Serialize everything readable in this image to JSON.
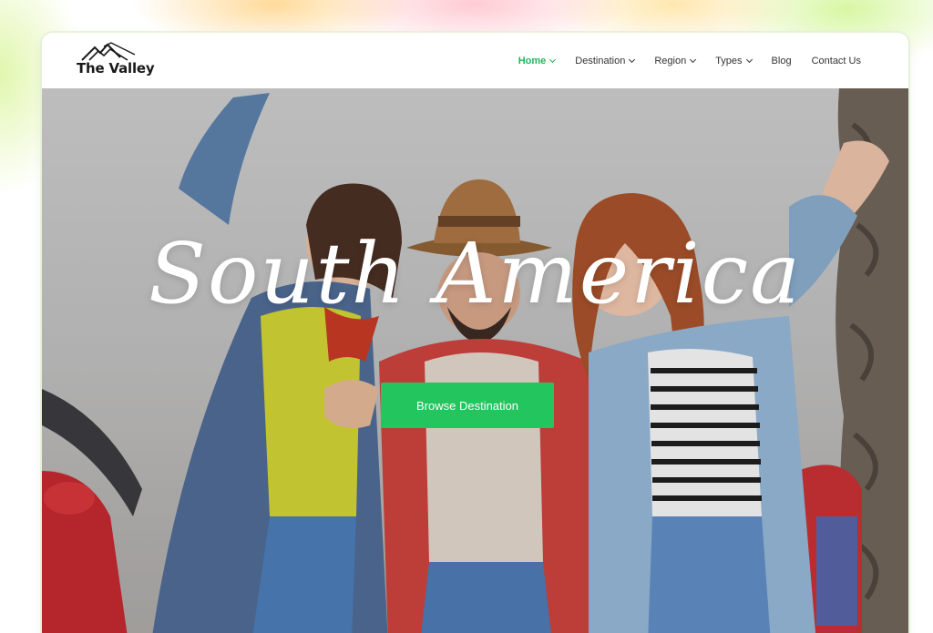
{
  "site": {
    "logo_text": "The Valley"
  },
  "nav": {
    "items": [
      {
        "label": "Home",
        "has_dropdown": true,
        "active": true
      },
      {
        "label": "Destination",
        "has_dropdown": true,
        "active": false
      },
      {
        "label": "Region",
        "has_dropdown": true,
        "active": false
      },
      {
        "label": "Types",
        "has_dropdown": true,
        "active": false
      },
      {
        "label": "Blog",
        "has_dropdown": false,
        "active": false
      },
      {
        "label": "Contact Us",
        "has_dropdown": false,
        "active": false
      }
    ]
  },
  "hero": {
    "title": "South America",
    "cta_label": "Browse Destination"
  },
  "colors": {
    "accent": "#22c55e",
    "nav_active": "#21b556",
    "nav_text": "#333333"
  }
}
